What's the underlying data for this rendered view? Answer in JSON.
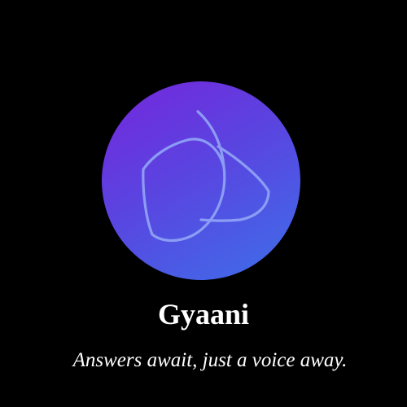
{
  "app": {
    "name": "Gyaani",
    "tagline": "Answers await, just a voice away.",
    "logo_icon": "leaf-icon"
  },
  "colors": {
    "background": "#000000",
    "logo_gradient_start": "#7526dc",
    "logo_gradient_end": "#3d6fe9",
    "logo_stroke": "#8fa2f5",
    "text": "#ffffff"
  }
}
